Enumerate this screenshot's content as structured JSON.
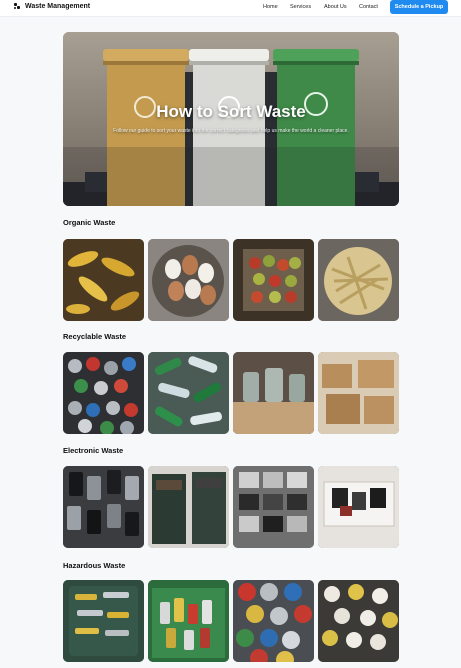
{
  "header": {
    "brand": "Waste Management",
    "nav": [
      {
        "label": "Home"
      },
      {
        "label": "Services"
      },
      {
        "label": "About Us"
      },
      {
        "label": "Contact"
      }
    ],
    "cta_label": "Schedule a Pickup",
    "accent_color": "#1f8bf0"
  },
  "hero": {
    "title": "How to Sort Waste",
    "subtitle": "Follow our guide to sort your waste into the correct categories and help us make the world a cleaner place.",
    "bin_colors": [
      "#c39a4e",
      "#d9d9d5",
      "#3f8a48"
    ]
  },
  "sections": [
    {
      "title": "Organic Waste",
      "images": [
        "bananas-photo",
        "eggs-photo",
        "apples-photo",
        "pasta-photo"
      ]
    },
    {
      "title": "Recyclable Waste",
      "images": [
        "cans-photo",
        "bottles-photo",
        "glass-jars-photo",
        "cardboard-boxes-photo"
      ]
    },
    {
      "title": "Electronic Waste",
      "images": [
        "phones-photo",
        "ewaste-bins-photo",
        "old-devices-photo",
        "electronics-box-photo"
      ]
    },
    {
      "title": "Hazardous Waste",
      "images": [
        "batteries-photo",
        "spray-cans-bin-photo",
        "paint-cans-photo",
        "light-bulbs-photo"
      ]
    }
  ]
}
